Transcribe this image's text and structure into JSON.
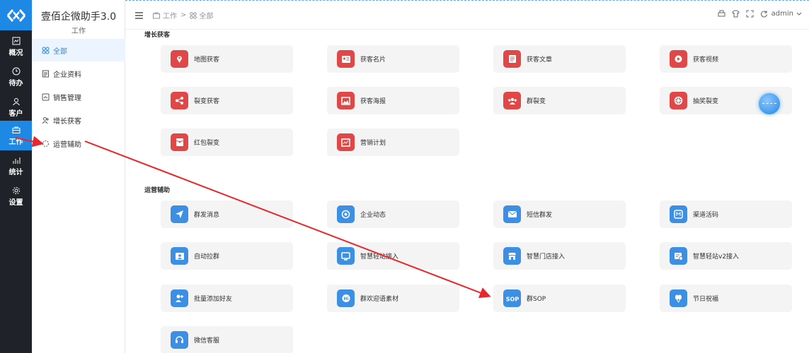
{
  "rail": {
    "items": [
      {
        "label": "概况",
        "icon": "overview-icon"
      },
      {
        "label": "待办",
        "icon": "clock-icon"
      },
      {
        "label": "客户",
        "icon": "customer-icon"
      },
      {
        "label": "工作",
        "icon": "briefcase-icon"
      },
      {
        "label": "统计",
        "icon": "stats-icon"
      },
      {
        "label": "设置",
        "icon": "gear-icon"
      }
    ]
  },
  "sidebar": {
    "title": "壹佰企微助手3.0",
    "subtitle": "工作",
    "items": [
      {
        "label": "全部"
      },
      {
        "label": "企业资料"
      },
      {
        "label": "销售管理"
      },
      {
        "label": "增长获客"
      },
      {
        "label": "运营辅助"
      }
    ]
  },
  "breadcrumb": {
    "root": "工作",
    "sep": ">",
    "current": "全部"
  },
  "header": {
    "user": "admin"
  },
  "sections": {
    "growth": {
      "title": "增长获客",
      "cards": [
        "地图获客",
        "获客名片",
        "获客文章",
        "获客视频",
        "裂变获客",
        "获客海报",
        "群裂变",
        "抽奖裂变",
        "红包裂变",
        "营销计划"
      ]
    },
    "ops": {
      "title": "运营辅助",
      "cards": [
        "群发消息",
        "企业动态",
        "短信群发",
        "渠道活码",
        "自动拉群",
        "智慧轻站接入",
        "智慧门店接入",
        "智慧轻站v2接入",
        "批量添加好友",
        "群欢迎语素材",
        "群SOP",
        "节日祝福",
        "微信客服"
      ]
    }
  },
  "colors": {
    "accent": "#1e88e5",
    "rail": "#1f2329",
    "red": "#e04848",
    "blue": "#3d8fe3",
    "arrow": "#e8262b"
  }
}
